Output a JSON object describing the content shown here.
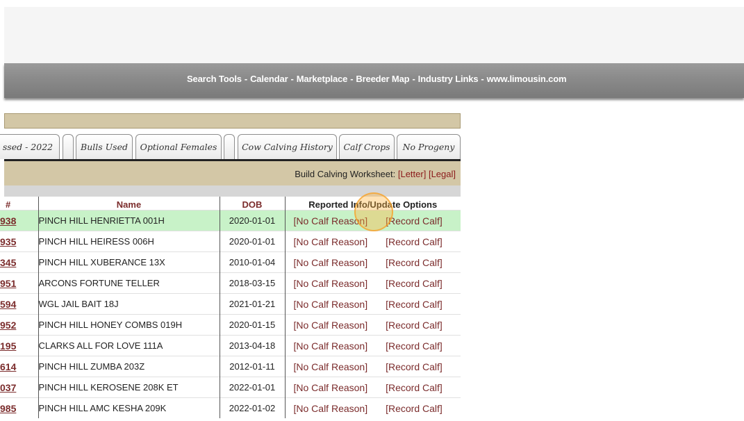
{
  "banner": {
    "links": [
      "Search Tools",
      "Calendar",
      "Marketplace",
      "Breeder Map",
      "Industry Links",
      "www.limousin.com"
    ],
    "separator": "-"
  },
  "tabs": [
    {
      "label": "ssed - 2022"
    },
    {
      "label": ""
    },
    {
      "label": "Bulls Used"
    },
    {
      "label": "Optional Females"
    },
    {
      "label": ""
    },
    {
      "label": "Cow Calving History"
    },
    {
      "label": "Calf Crops"
    },
    {
      "label": "No Progeny"
    }
  ],
  "worksheet": {
    "label": "Build Calving Worksheet:",
    "letter": "[Letter]",
    "legal": "[Legal]"
  },
  "table": {
    "headers": {
      "num": "#",
      "name": "Name",
      "dob": "DOB",
      "options": "Reported Info/Update Options"
    },
    "rows": [
      {
        "num": "938",
        "name": "PINCH HILL HENRIETTA 001H",
        "dob": "2020-01-01",
        "no_calf": "[No Calf Reason]",
        "record": "[Record Calf]",
        "highlighted": true
      },
      {
        "num": "935",
        "name": "PINCH HILL HEIRESS 006H",
        "dob": "2020-01-01",
        "no_calf": "[No Calf Reason]",
        "record": "[Record Calf]"
      },
      {
        "num": "345",
        "name": "PINCH HILL XUBERANCE 13X",
        "dob": "2010-01-04",
        "no_calf": "[No Calf Reason]",
        "record": "[Record Calf]"
      },
      {
        "num": "951",
        "name": "ARCONS FORTUNE TELLER",
        "dob": "2018-03-15",
        "no_calf": "[No Calf Reason]",
        "record": "[Record Calf]"
      },
      {
        "num": "594",
        "name": "WGL JAIL BAIT 18J",
        "dob": "2021-01-21",
        "no_calf": "[No Calf Reason]",
        "record": "[Record Calf]"
      },
      {
        "num": "952",
        "name": "PINCH HILL HONEY COMBS 019H",
        "dob": "2020-01-15",
        "no_calf": "[No Calf Reason]",
        "record": "[Record Calf]"
      },
      {
        "num": "195",
        "name": "CLARKS ALL FOR LOVE 111A",
        "dob": "2013-04-18",
        "no_calf": "[No Calf Reason]",
        "record": "[Record Calf]"
      },
      {
        "num": "614",
        "name": "PINCH HILL ZUMBA 203Z",
        "dob": "2012-01-11",
        "no_calf": "[No Calf Reason]",
        "record": "[Record Calf]"
      },
      {
        "num": "037",
        "name": "PINCH HILL KEROSENE 208K ET",
        "dob": "2022-01-01",
        "no_calf": "[No Calf Reason]",
        "record": "[Record Calf]"
      },
      {
        "num": "985",
        "name": "PINCH HILL AMC KESHA 209K",
        "dob": "2022-01-02",
        "no_calf": "[No Calf Reason]",
        "record": "[Record Calf]"
      }
    ]
  },
  "colors": {
    "link": "#7b2c2c",
    "tan": "#d3c7a6",
    "highlight": "#c8f2c8",
    "banner": "#8a8a8a"
  }
}
